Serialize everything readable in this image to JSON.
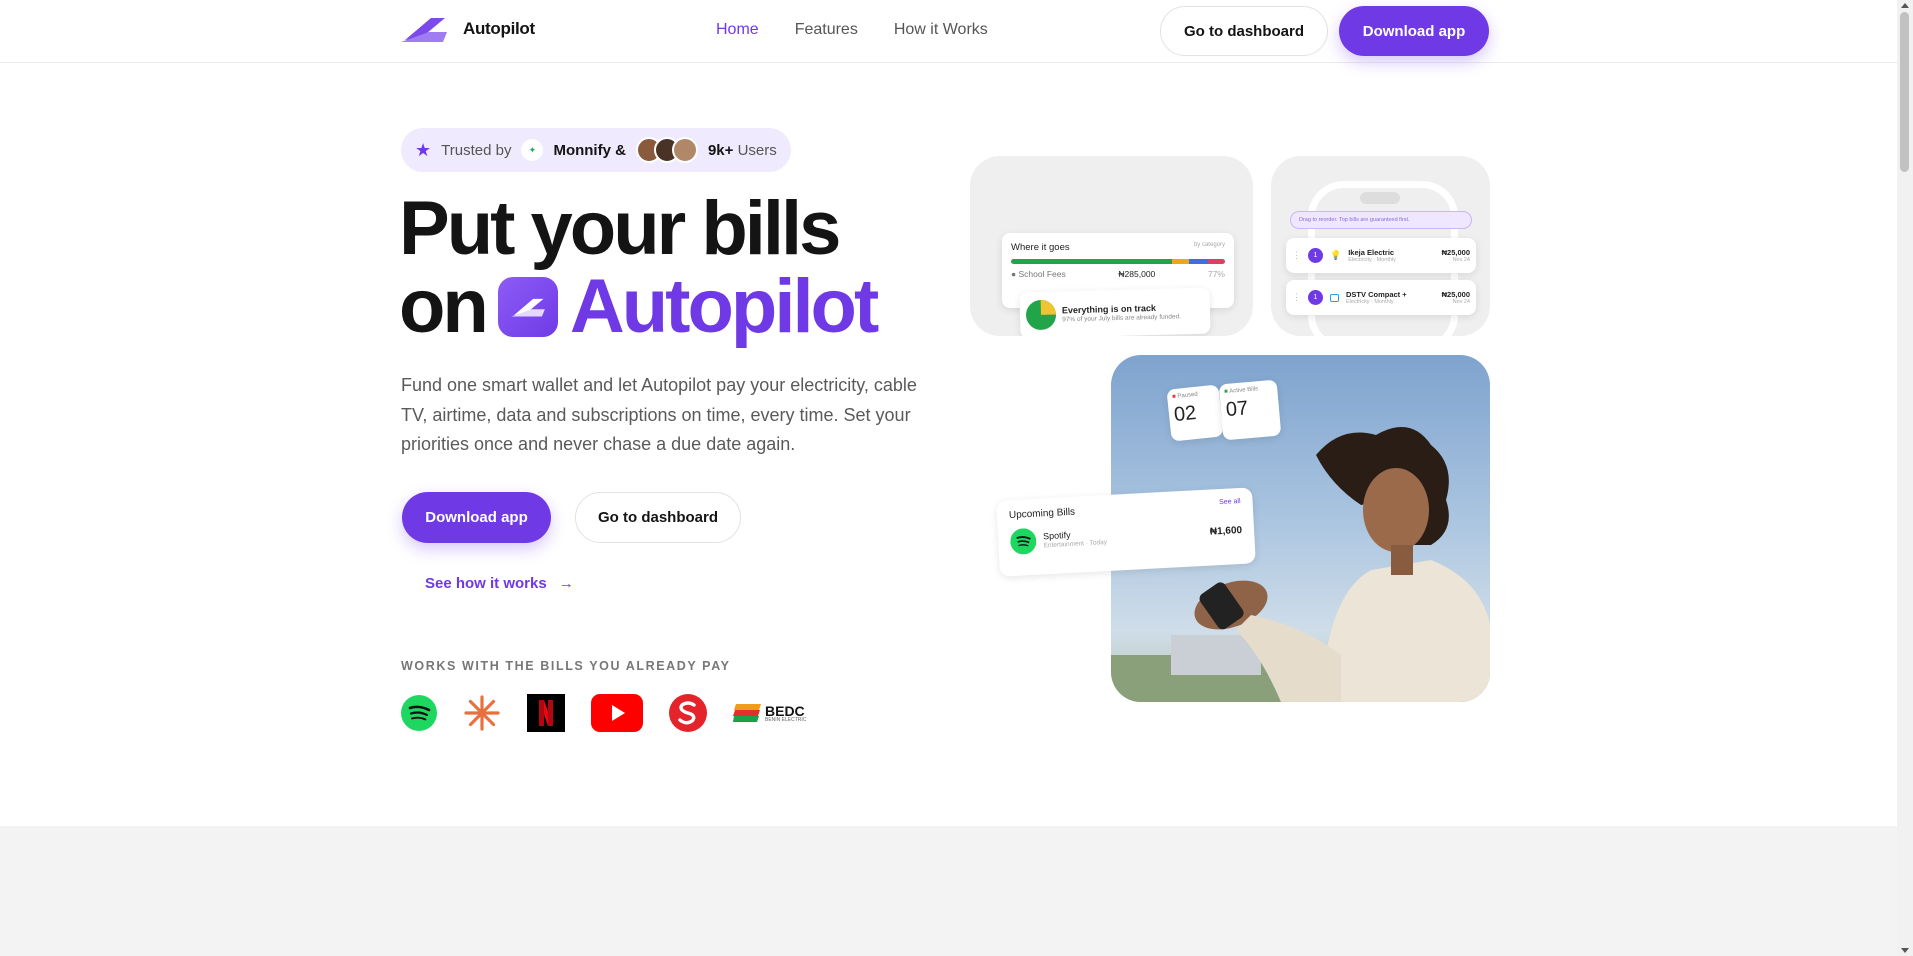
{
  "nav": {
    "brand": "Autopilot",
    "links": [
      "Home",
      "Features",
      "How it Works"
    ],
    "dashboard_label": "Go to dashboard",
    "download_label": "Download app"
  },
  "trusted": {
    "prefix": "Trusted by",
    "brand": "Monnify &",
    "count": "9k+",
    "suffix": "Users"
  },
  "hero": {
    "line1": "Put your bills",
    "line2_word": "on",
    "line2_brand": "Autopilot",
    "description": "Fund one smart wallet and let Autopilot pay your electricity, cable TV, airtime, data and subscriptions on time, every time. Set your priorities once and never chase a due date again.",
    "download_label": "Download app",
    "dashboard_label": "Go to dashboard",
    "see_how_label": "See how it works"
  },
  "works_with": {
    "title": "WORKS WITH THE BILLS YOU ALREADY PAY",
    "logos": [
      "spotify-logo",
      "claude-logo",
      "netflix-logo",
      "youtube-logo",
      "startimes-logo",
      "bedc-logo"
    ],
    "bedc_name": "BEDC",
    "bedc_sub": "BENIN ELECTRIC"
  },
  "card1": {
    "title": "Where it goes",
    "tag": "by category",
    "row_label": "School Fees",
    "row_amount": "₦285,000",
    "row_pct": "77%",
    "status_title": "Everything is on track",
    "status_sub": "97% of your July bills are already funded."
  },
  "card2": {
    "hint": "Drag to reorder. Top bills are guaranteed first.",
    "items": [
      {
        "rank": "1",
        "name": "Ikeja Electric",
        "sub": "Electricity · Monthly",
        "amount": "₦25,000",
        "date": "Nov 24"
      },
      {
        "rank": "1",
        "name": "DSTV Compact +",
        "sub": "Electricity · Monthly",
        "amount": "₦25,000",
        "date": "Nov 24"
      }
    ]
  },
  "card3": {
    "paused_label": "Paused",
    "paused_value": "02",
    "active_label": "Active Bills",
    "active_value": "07",
    "upcoming_title": "Upcoming Bills",
    "see_all": "See all",
    "bill_name": "Spotify",
    "bill_sub": "Entertainment · Today",
    "bill_amount": "₦1,600"
  },
  "colors": {
    "accent": "#6f3ae6",
    "accent_bg": "#efeafd"
  }
}
